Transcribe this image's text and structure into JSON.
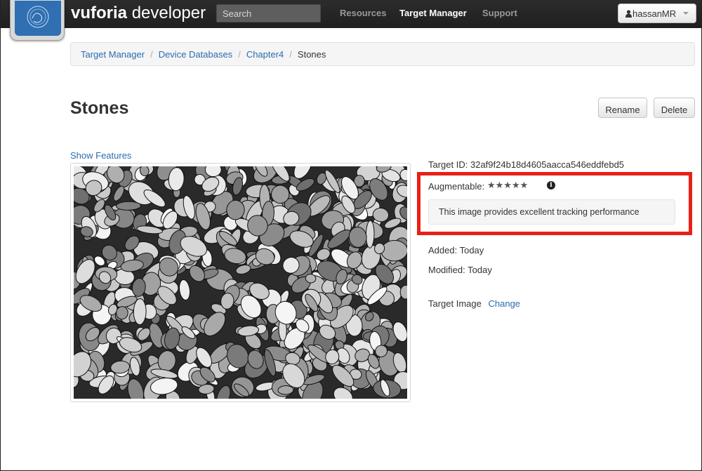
{
  "navbar": {
    "brand_bold": "vuforia",
    "brand_light": "developer",
    "search_placeholder": "Search",
    "links": [
      {
        "label": "Resources",
        "active": false
      },
      {
        "label": "Target Manager",
        "active": true
      },
      {
        "label": "Support",
        "active": false
      }
    ],
    "user": "hassanMR"
  },
  "breadcrumb": {
    "items": [
      "Target Manager",
      "Device Databases",
      "Chapter4"
    ],
    "separator": "/",
    "current": "Stones"
  },
  "page": {
    "title": "Stones",
    "rename_label": "Rename",
    "delete_label": "Delete",
    "show_features": "Show Features"
  },
  "target": {
    "id_label": "Target ID:",
    "id_value": "32af9f24b18d4605aacca546eddfebd5",
    "augmentable_label": "Augmentable:",
    "rating_stars": 5,
    "stars_glyphs": "★★★★★",
    "tracking_message": "This image provides excellent tracking performance",
    "added_label": "Added:",
    "added_value": "Today",
    "modified_label": "Modified:",
    "modified_value": "Today",
    "image_label": "Target Image",
    "change_label": "Change"
  },
  "colors": {
    "navbar_bg": "#1f1f1f",
    "link_blue": "#2a6cb0",
    "highlight_red": "#e82017",
    "logo_blue": "#2f6fb2"
  },
  "icons": {
    "logo": "vuforia-logo-icon",
    "user": "user-icon",
    "dropdown": "caret-down-icon",
    "info": "info-icon"
  }
}
